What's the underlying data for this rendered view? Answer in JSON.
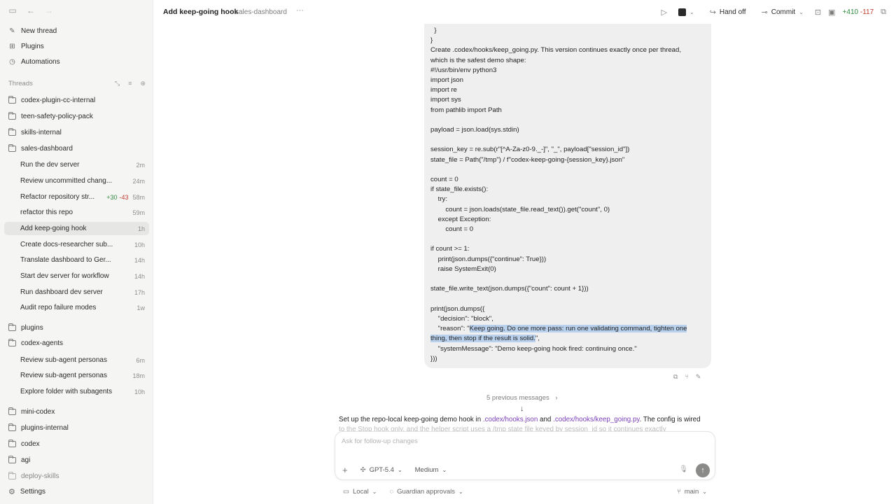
{
  "sidebar": {
    "nav": [
      {
        "label": "New thread",
        "icon": "edit-icon"
      },
      {
        "label": "Plugins",
        "icon": "grid-icon"
      },
      {
        "label": "Automations",
        "icon": "clock-icon"
      }
    ],
    "threads_header": "Threads",
    "folders_top": [
      "codex-plugin-cc-internal",
      "teen-safety-policy-pack",
      "skills-internal",
      "sales-dashboard"
    ],
    "sales_threads": [
      {
        "title": "Run the dev server",
        "time": "2m"
      },
      {
        "title": "Review uncommitted chang...",
        "time": "24m"
      },
      {
        "title": "Refactor repository str...",
        "add": "+30",
        "del": "-43",
        "time": "58m"
      },
      {
        "title": "refactor this repo",
        "time": "59m"
      },
      {
        "title": "Add keep-going hook",
        "time": "1h"
      },
      {
        "title": "Create docs-researcher sub...",
        "time": "10h"
      },
      {
        "title": "Translate dashboard to Ger...",
        "time": "14h"
      },
      {
        "title": "Start dev server for workflow",
        "time": "14h"
      },
      {
        "title": "Run dashboard dev server",
        "time": "17h"
      },
      {
        "title": "Audit repo failure modes",
        "time": "1w"
      }
    ],
    "folders_mid": [
      "plugins",
      "codex-agents"
    ],
    "agent_threads": [
      {
        "title": "Review sub-agent personas",
        "time": "6m"
      },
      {
        "title": "Review sub-agent personas",
        "time": "18m"
      },
      {
        "title": "Explore folder with subagents",
        "time": "10h"
      }
    ],
    "folders_bottom": [
      "mini-codex",
      "plugins-internal",
      "codex",
      "agi",
      "deploy-skills"
    ],
    "settings": "Settings"
  },
  "topbar": {
    "title": "Add keep-going hook",
    "project": "sales-dashboard",
    "more": "···",
    "hand_off": "Hand off",
    "commit": "Commit",
    "diff_add": "+410",
    "diff_del": "-117"
  },
  "code": {
    "before": "  }\n}\nCreate .codex/hooks/keep_going.py. This version continues exactly once per thread,\nwhich is the safest demo shape:\n#!/usr/bin/env python3\nimport json\nimport re\nimport sys\nfrom pathlib import Path\n\npayload = json.load(sys.stdin)\n\nsession_key = re.sub(r\"[^A-Za-z0-9._-]\", \"_\", payload[\"session_id\"])\nstate_file = Path(\"/tmp\") / f\"codex-keep-going-{session_key}.json\"\n\ncount = 0\nif state_file.exists():\n    try:\n        count = json.loads(state_file.read_text()).get(\"count\", 0)\n    except Exception:\n        count = 0\n\nif count >= 1:\n    print(json.dumps({\"continue\": True}))\n    raise SystemExit(0)\n\nstate_file.write_text(json.dumps({\"count\": count + 1}))\n\nprint(json.dumps({\n    \"decision\": \"block\",\n    \"reason\": \"",
    "highlight": "Keep going. Do one more pass: run one validating command, tighten one\nthing, then stop if the result is solid.",
    "after": "\",\n    \"systemMessage\": \"Demo keep-going hook fired: continuing once.\"\n}))"
  },
  "previous_messages": "5 previous messages",
  "assistant": {
    "p1": "Set up the repo-local keep-going demo hook in ",
    "path1": ".codex/hooks.json",
    "p2": " and ",
    "path2": ".codex/hooks/keep_going.py",
    "p3": ". The config is wired",
    "p4": "to the Stop hook only, and the helper script uses a /tmp state file keyed by session_id so it continues exactly"
  },
  "composer": {
    "placeholder": "Ask for follow-up changes",
    "model": "GPT-5.4",
    "effort": "Medium"
  },
  "footer": {
    "local": "Local",
    "approvals": "Guardian approvals",
    "branch": "main"
  }
}
